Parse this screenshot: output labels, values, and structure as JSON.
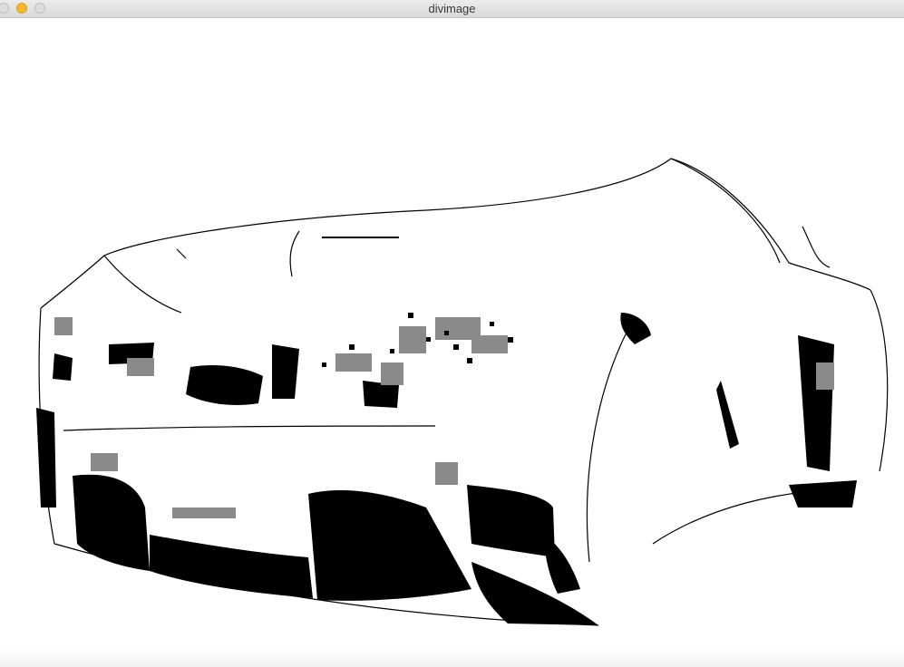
{
  "window": {
    "title": "divimage",
    "buttons": {
      "close_icon": "close-icon",
      "minimize_icon": "minimize-icon",
      "zoom_icon": "zoom-icon"
    },
    "minimize_color": "#F5B82E"
  },
  "image": {
    "subject_icon": "car-front-icon"
  }
}
